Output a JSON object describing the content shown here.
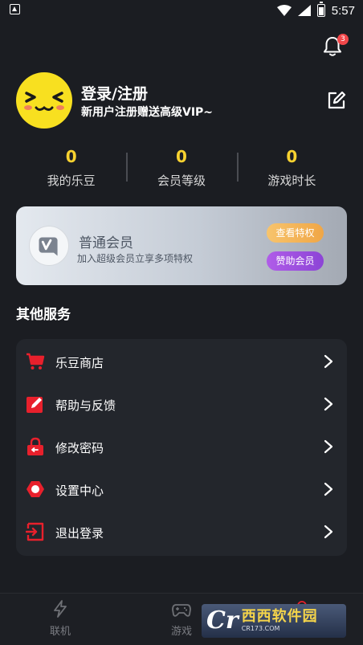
{
  "status_bar": {
    "time": "5:57"
  },
  "notifications": {
    "badge_count": "3"
  },
  "profile": {
    "name": "登录/注册",
    "subtitle": "新用户注册赠送高级VIP~"
  },
  "stats": [
    {
      "value": "0",
      "label": "我的乐豆"
    },
    {
      "value": "0",
      "label": "会员等级"
    },
    {
      "value": "0",
      "label": "游戏时长"
    }
  ],
  "member_card": {
    "title": "普通会员",
    "description": "加入超级会员立享多项特权",
    "view_button": "查看特权",
    "sponsor_button": "赞助会员"
  },
  "services": {
    "title": "其他服务",
    "items": [
      {
        "label": "乐豆商店",
        "icon": "cart-icon"
      },
      {
        "label": "帮助与反馈",
        "icon": "feedback-icon"
      },
      {
        "label": "修改密码",
        "icon": "lock-icon"
      },
      {
        "label": "设置中心",
        "icon": "settings-icon"
      },
      {
        "label": "退出登录",
        "icon": "logout-icon"
      }
    ]
  },
  "bottom_nav": {
    "items": [
      {
        "label": "联机",
        "icon": "lightning-icon"
      },
      {
        "label": "游戏",
        "icon": "gamepad-icon"
      }
    ]
  },
  "watermark": {
    "logo_text": "Cr",
    "brand": "西西软件园",
    "url": "CR173.COM"
  },
  "colors": {
    "background": "#1b1d22",
    "stat_value": "#f8d230",
    "card_panel": "#23262c",
    "icon_red": "#e8202c",
    "badge_red": "#f2474a"
  }
}
